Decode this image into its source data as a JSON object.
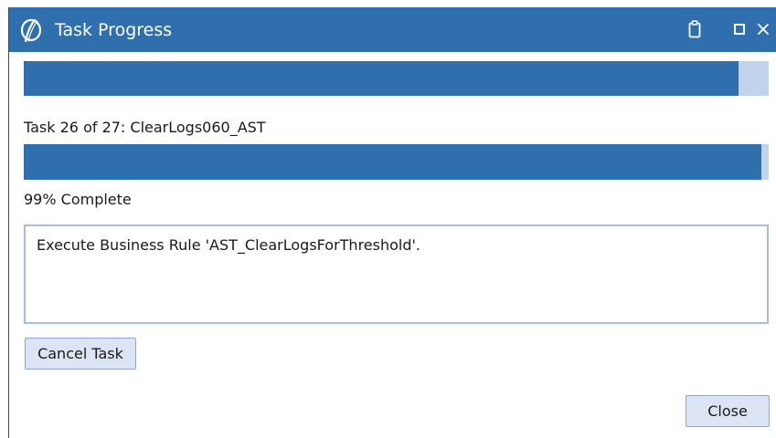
{
  "window": {
    "title": "Task Progress",
    "title_bar_color": "#2f6fad",
    "controls": {
      "clipboard_icon": "clipboard-icon",
      "maximize_icon": "maximize-icon",
      "close_icon": "close-icon"
    }
  },
  "overall_progress": {
    "fraction": 0.96,
    "fill_color": "#2f6fad",
    "track_color": "#c2d4eb"
  },
  "task": {
    "label": "Task 26 of 27: ClearLogs060_AST"
  },
  "task_progress": {
    "percent": 99,
    "label": "99% Complete"
  },
  "message": {
    "text": "Execute Business Rule 'AST_ClearLogsForThreshold'."
  },
  "buttons": {
    "cancel_label": "Cancel Task",
    "close_label": "Close"
  }
}
